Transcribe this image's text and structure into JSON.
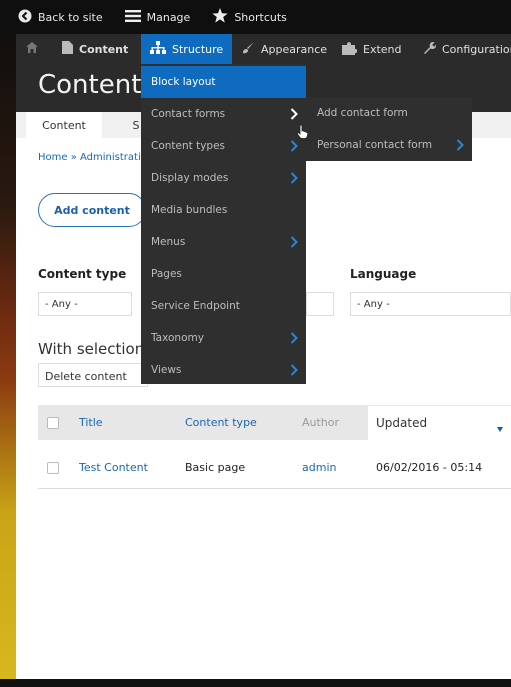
{
  "toolbar": {
    "back_label": "Back to site",
    "manage_label": "Manage",
    "shortcuts_label": "Shortcuts"
  },
  "tray": {
    "items": [
      {
        "label": "",
        "icon": "home-icon"
      },
      {
        "label": "Content",
        "icon": "document-icon"
      },
      {
        "label": "Structure",
        "icon": "sitemap-icon"
      },
      {
        "label": "Appearance",
        "icon": "paintbrush-icon"
      },
      {
        "label": "Extend",
        "icon": "puzzle-icon"
      },
      {
        "label": "Configuration",
        "icon": "wrench-icon"
      }
    ]
  },
  "page": {
    "title": "Content",
    "tabs": [
      "Content",
      "S"
    ],
    "breadcrumb": "Home » Administrati",
    "add_button": "Add content",
    "filters": {
      "content_type_label": "Content type",
      "content_type_value": "- Any -",
      "language_label": "Language",
      "language_value": "- Any -"
    },
    "with_selection_label": "With selection",
    "bulk_action_value": "Delete content"
  },
  "table": {
    "headers": [
      "Title",
      "Content type",
      "Author",
      "Updated"
    ],
    "rows": [
      {
        "title": "Test Content",
        "type": "Basic page",
        "author": "admin",
        "updated": "06/02/2016 - 05:14"
      }
    ]
  },
  "structure_menu": {
    "items": [
      {
        "label": "Block layout",
        "has_sub": false
      },
      {
        "label": "Contact forms",
        "has_sub": true
      },
      {
        "label": "Content types",
        "has_sub": true
      },
      {
        "label": "Display modes",
        "has_sub": true
      },
      {
        "label": "Media bundles",
        "has_sub": false
      },
      {
        "label": "Menus",
        "has_sub": true
      },
      {
        "label": "Pages",
        "has_sub": false
      },
      {
        "label": "Service Endpoint",
        "has_sub": false
      },
      {
        "label": "Taxonomy",
        "has_sub": true
      },
      {
        "label": "Views",
        "has_sub": true
      }
    ]
  },
  "contact_forms_submenu": {
    "items": [
      {
        "label": "Add contact form"
      },
      {
        "label": "Personal contact form"
      }
    ]
  },
  "colors": {
    "accent": "#0f6bbd",
    "link": "#1a67b0",
    "menu_bg": "#2f2f2f",
    "toolbar_bg": "#0f0f0f"
  }
}
